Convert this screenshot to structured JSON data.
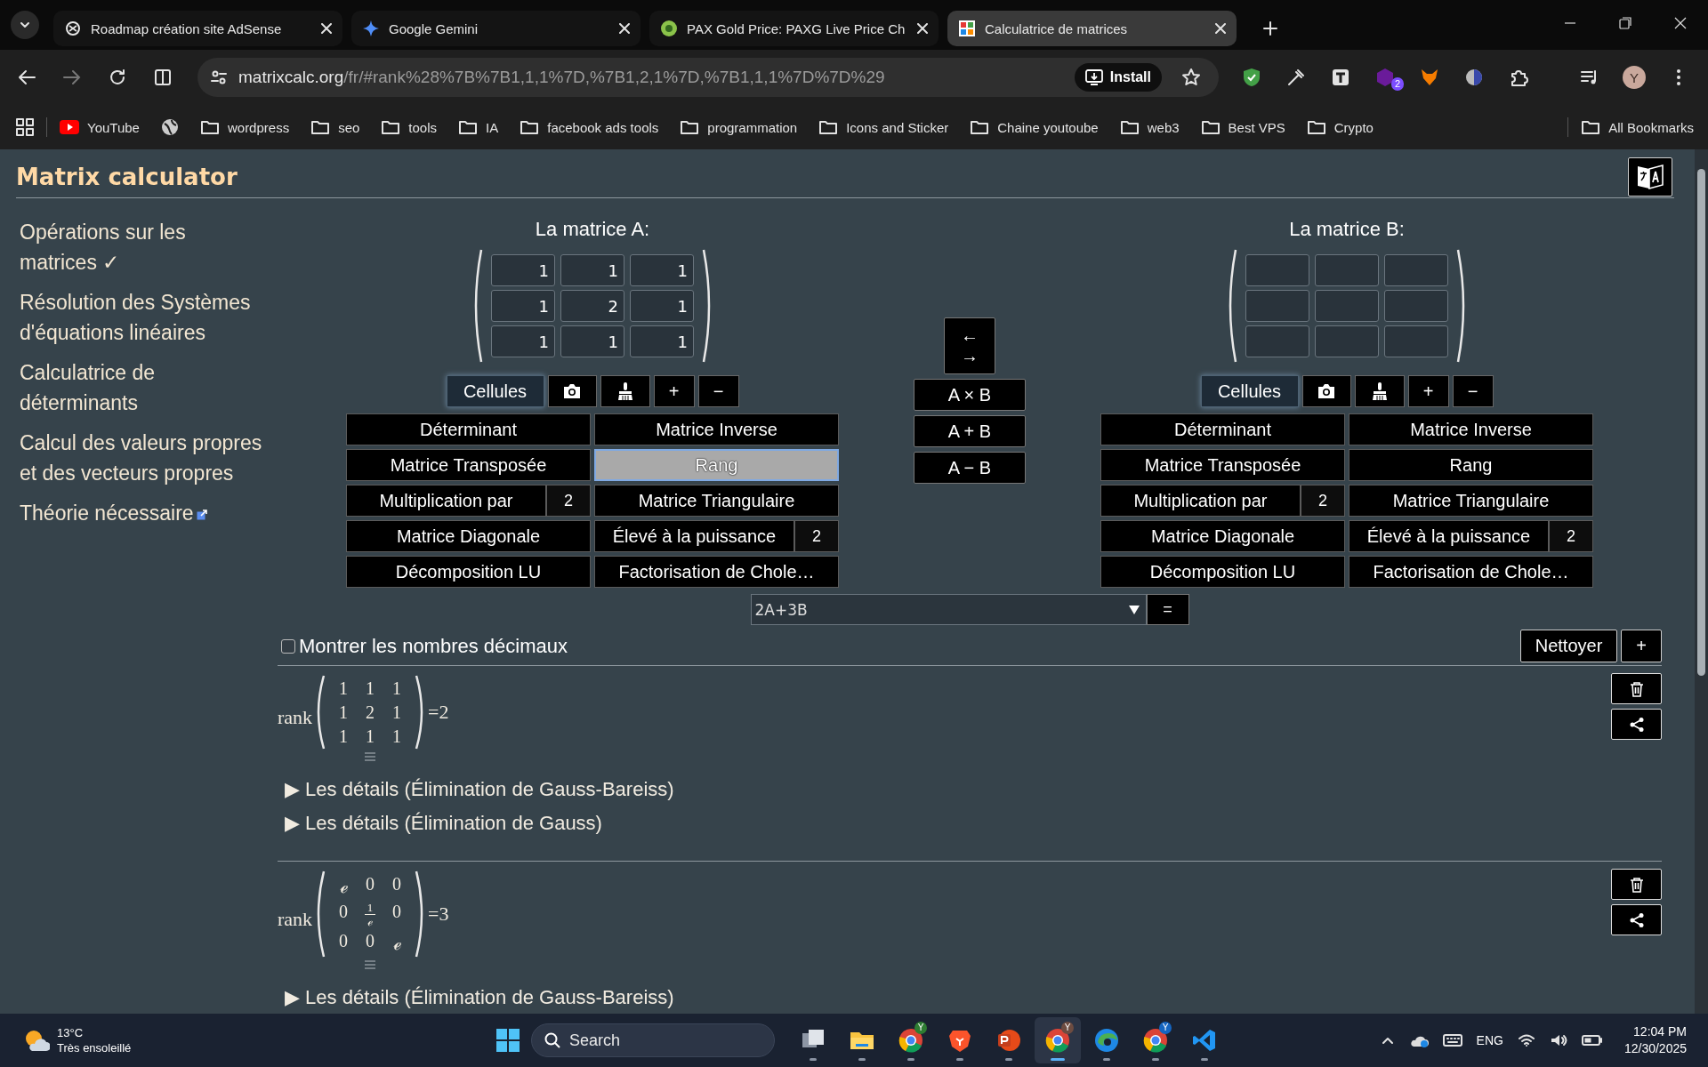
{
  "browser": {
    "tabs": [
      {
        "title": "Roadmap création site AdSense",
        "selected": false
      },
      {
        "title": "Google Gemini",
        "selected": false
      },
      {
        "title": "PAX Gold Price: PAXG Live Price Ch",
        "selected": false
      },
      {
        "title": "Calculatrice de matrices",
        "selected": true
      }
    ],
    "address": {
      "host": "matrixcalc.org",
      "path": "/fr/#rank%28%7B%7B1,1,1%7D,%7B1,2,1%7D,%7B1,1,1%7D%7D%29"
    },
    "install_button": "Install",
    "extension_badge": "2",
    "profile_initial": "Y",
    "bookmarks": [
      {
        "label": "YouTube",
        "kind": "site"
      },
      {
        "kind": "globe"
      },
      {
        "label": "wordpress",
        "kind": "folder"
      },
      {
        "label": "seo",
        "kind": "folder"
      },
      {
        "label": "tools",
        "kind": "folder"
      },
      {
        "label": "IA",
        "kind": "folder"
      },
      {
        "label": "facebook ads tools",
        "kind": "folder"
      },
      {
        "label": "programmation",
        "kind": "folder"
      },
      {
        "label": "Icons and Sticker",
        "kind": "folder"
      },
      {
        "label": "Chaine youtoube",
        "kind": "folder"
      },
      {
        "label": "web3",
        "kind": "folder"
      },
      {
        "label": "Best VPS",
        "kind": "folder"
      },
      {
        "label": "Crypto",
        "kind": "folder"
      }
    ],
    "all_bookmarks": "All Bookmarks"
  },
  "page": {
    "title": "Matrix calculator",
    "sidebar": [
      {
        "label": "Opérations sur les matrices ✓",
        "external": false
      },
      {
        "label": "Résolution des Systèmes d'équations linéaires",
        "external": false
      },
      {
        "label": "Calculatrice de déterminants",
        "external": false
      },
      {
        "label": "Calcul des valeurs propres et des vecteurs propres",
        "external": false
      },
      {
        "label": "Théorie nécessaire",
        "external": true
      }
    ],
    "matrices": [
      {
        "title": "La matrice A:",
        "cells": [
          [
            "1",
            "1",
            "1"
          ],
          [
            "1",
            "2",
            "1"
          ],
          [
            "1",
            "1",
            "1"
          ]
        ],
        "cells_button": "Cellules",
        "size_buttons": [
          "+",
          "−"
        ],
        "operations": [
          {
            "label": "Déterminant",
            "selected": false
          },
          {
            "label": "Matrice Inverse",
            "selected": false
          },
          {
            "label": "Matrice Transposée",
            "selected": false
          },
          {
            "label": "Rang",
            "selected": true
          },
          {
            "label": "Multiplication par",
            "input": "2",
            "selected": false
          },
          {
            "label": "Matrice Triangulaire",
            "selected": false
          },
          {
            "label": "Matrice Diagonale",
            "selected": false
          },
          {
            "label": "Élevé à la puissance",
            "input": "2",
            "selected": false
          },
          {
            "label": "Décomposition LU",
            "selected": false
          },
          {
            "label": "Factorisation de Chole…",
            "selected": false
          }
        ]
      },
      {
        "title": "La matrice B:",
        "cells": [
          [
            null,
            null,
            null
          ],
          [
            null,
            null,
            null
          ],
          [
            null,
            null,
            null
          ]
        ],
        "cells_button": "Cellules",
        "size_buttons": [
          "+",
          "−"
        ],
        "operations": [
          {
            "label": "Déterminant",
            "selected": false
          },
          {
            "label": "Matrice Inverse",
            "selected": false
          },
          {
            "label": "Matrice Transposée",
            "selected": false
          },
          {
            "label": "Rang",
            "selected": false
          },
          {
            "label": "Multiplication par",
            "input": "2",
            "selected": false
          },
          {
            "label": "Matrice Triangulaire",
            "selected": false
          },
          {
            "label": "Matrice Diagonale",
            "selected": false
          },
          {
            "label": "Élevé à la puissance",
            "input": "2",
            "selected": false
          },
          {
            "label": "Décomposition LU",
            "selected": false
          },
          {
            "label": "Factorisation de Chole…",
            "selected": false
          }
        ]
      }
    ],
    "swap_button": [
      "←",
      "→"
    ],
    "binary_operations": [
      "A × B",
      "A + B",
      "A − B"
    ],
    "expression": {
      "value": "2A+3B"
    },
    "equals_button": "=",
    "decimals": {
      "label": "Montrer les nombres décimaux",
      "checked": false
    },
    "clear_button": "Nettoyer",
    "add_button": "+",
    "results": [
      {
        "function": "rank",
        "matrix": [
          [
            "1",
            "1",
            "1"
          ],
          [
            "1",
            "2",
            "1"
          ],
          [
            "1",
            "1",
            "1"
          ]
        ],
        "result": "=2",
        "details": [
          "▶ Les détails (Élimination de Gauss-Bareiss)",
          "▶ Les détails (Élimination de Gauss)"
        ]
      },
      {
        "function": "rank",
        "matrix": [
          [
            "ℯ",
            "0",
            "0"
          ],
          [
            "0",
            {
              "numerator": "1",
              "denominator": "ℯ"
            },
            "0"
          ],
          [
            "0",
            "0",
            "ℯ"
          ]
        ],
        "result": "=3",
        "details": [
          "▶ Les détails (Élimination de Gauss-Bareiss)"
        ]
      }
    ]
  },
  "taskbar": {
    "weather": {
      "temperature": "13°C",
      "condition": "Très ensoleillé"
    },
    "search": "Search",
    "apps": [
      {
        "active": false
      },
      {
        "active": false
      },
      {
        "badge": "Y",
        "active": false
      },
      {
        "active": false
      },
      {
        "active": false
      },
      {
        "badge": "Y",
        "active": true
      },
      {
        "active": false
      },
      {
        "badge": "Y",
        "active": false
      },
      {
        "active": false
      }
    ],
    "language": "ENG",
    "time": "12:04 PM",
    "date": "12/30/2025"
  }
}
